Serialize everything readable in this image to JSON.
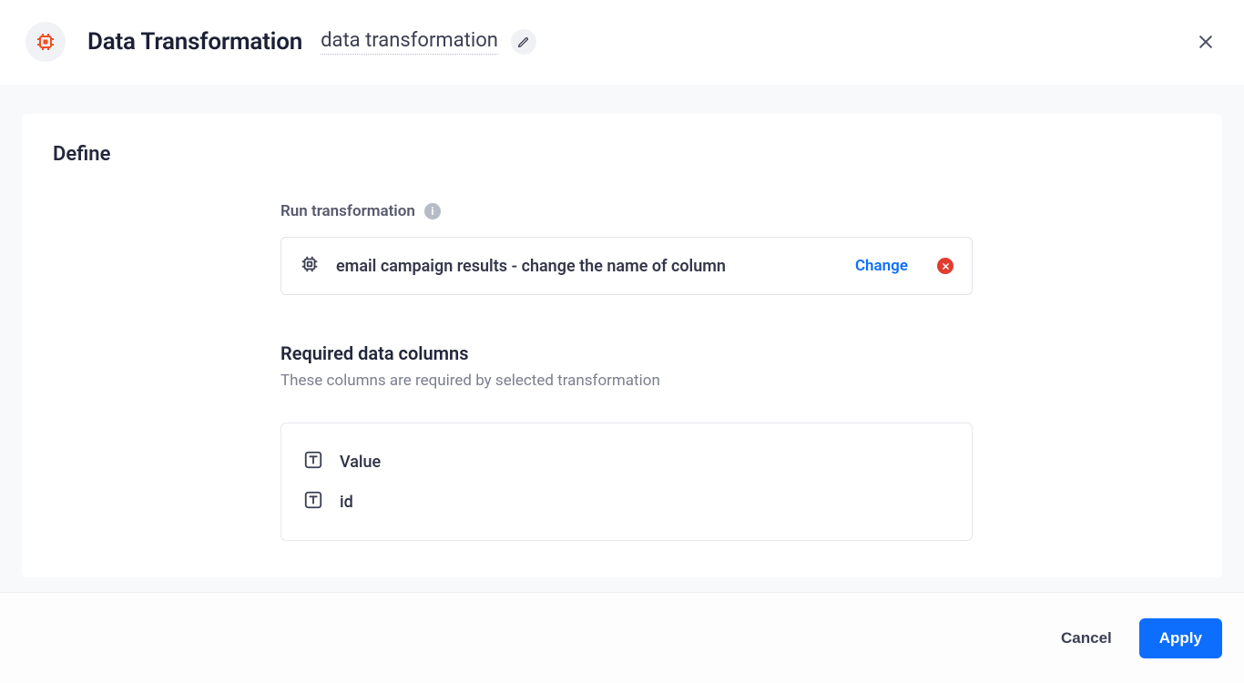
{
  "header": {
    "title": "Data Transformation",
    "subtitle": "data transformation"
  },
  "define": {
    "section_title": "Define",
    "run_label": "Run transformation",
    "selected_transformation": "email campaign results - change the name of column",
    "change_label": "Change",
    "required_heading": "Required data columns",
    "required_desc": "These columns are required by selected transformation",
    "columns": {
      "0": {
        "name": "Value"
      },
      "1": {
        "name": "id"
      }
    }
  },
  "footer": {
    "cancel": "Cancel",
    "apply": "Apply"
  }
}
